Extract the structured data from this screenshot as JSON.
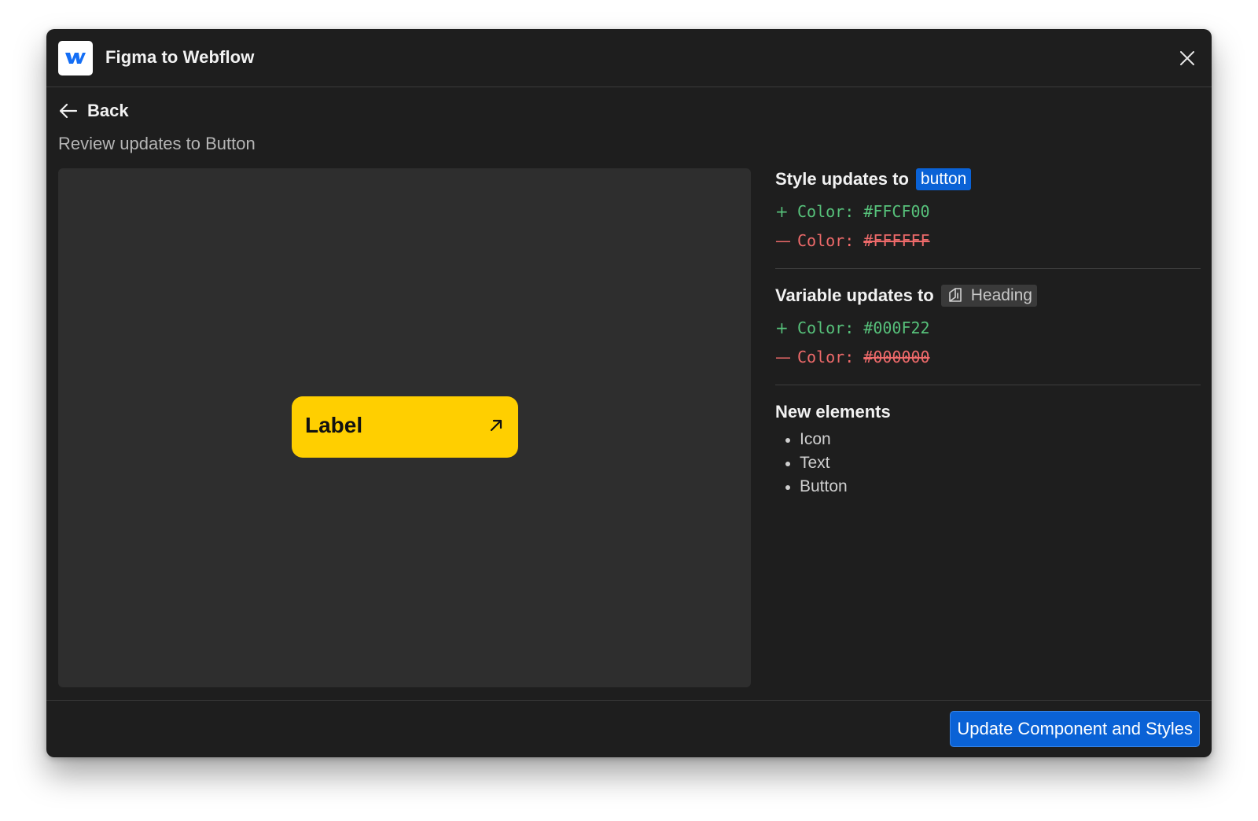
{
  "window": {
    "title": "Figma to Webflow",
    "logo_icon": "webflow-logo-icon",
    "close_icon": "close-icon"
  },
  "nav": {
    "back_label": "Back",
    "back_icon": "arrow-left-icon"
  },
  "subtitle": "Review updates to Button",
  "preview": {
    "button_label": "Label",
    "button_icon": "arrow-up-right-icon",
    "button_color": "#FFCF00"
  },
  "style_updates": {
    "heading": "Style updates to",
    "target": "button",
    "added": {
      "sign": "+",
      "key": "Color:",
      "value": "#FFCF00"
    },
    "removed": {
      "sign": "—",
      "key": "Color:",
      "value": "#FFFFFF"
    }
  },
  "variable_updates": {
    "heading": "Variable updates to",
    "target": "Heading",
    "target_icon": "variable-collection-icon",
    "added": {
      "sign": "+",
      "key": "Color:",
      "value": "#000F22"
    },
    "removed": {
      "sign": "—",
      "key": "Color:",
      "value": "#000000"
    }
  },
  "new_elements": {
    "heading": "New elements",
    "items": [
      "Icon",
      "Text",
      "Button"
    ]
  },
  "footer": {
    "primary_label": "Update Component and Styles"
  },
  "colors": {
    "accent": "#0A62D6",
    "added": "#57C27B",
    "removed": "#EE6A6A",
    "background": "#1E1E1E"
  }
}
